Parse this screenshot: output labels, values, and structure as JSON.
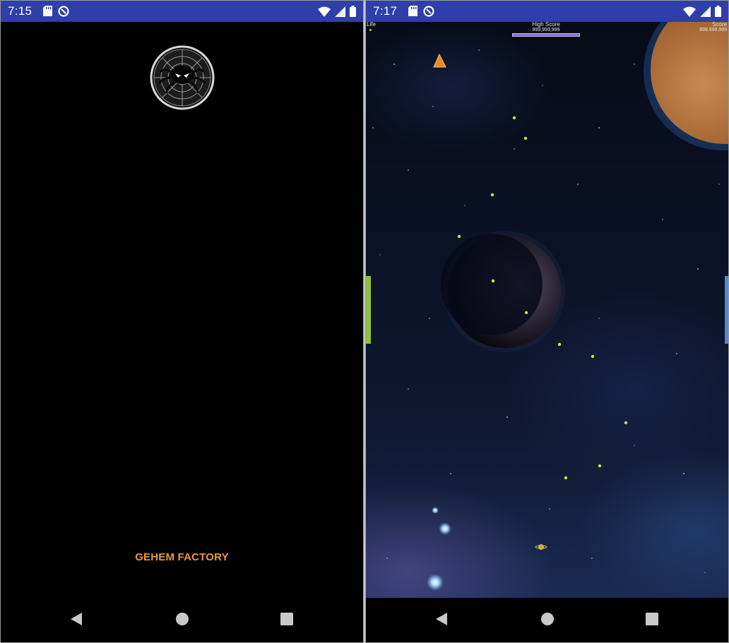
{
  "left_screen": {
    "status_bar": {
      "time": "7:15",
      "icons": [
        "sd-card-icon",
        "sync-icon",
        "wifi-icon",
        "signal-icon",
        "battery-icon"
      ]
    },
    "splash": {
      "logo_icon": "spider-web-logo-icon",
      "brand_text": "GEHEM FACTORY",
      "brand_color": "#e8963a"
    },
    "nav_bar": {
      "icons": [
        "back-icon",
        "home-icon",
        "recents-icon"
      ]
    }
  },
  "right_screen": {
    "status_bar": {
      "time": "7:17",
      "icons": [
        "sd-card-icon",
        "sync-icon",
        "wifi-icon",
        "signal-icon",
        "battery-icon"
      ]
    },
    "hud": {
      "life_label": "Life",
      "high_score_label": "High Score",
      "high_score_value": "999,999,999",
      "score_label": "Score",
      "score_value": "999,999,999"
    },
    "game": {
      "player_icon": "spaceship-triangle-icon",
      "enemy_bullet_color": "#d6e040",
      "background": "starfield-with-planets"
    },
    "nav_bar": {
      "icons": [
        "back-icon",
        "home-icon",
        "recents-icon"
      ]
    }
  },
  "colors": {
    "status_bar": "#2f3ea8",
    "life_gauge": "#8fc23a",
    "energy_gauge": "#4a8ad8",
    "high_score_bar": "#8a6ec8"
  }
}
